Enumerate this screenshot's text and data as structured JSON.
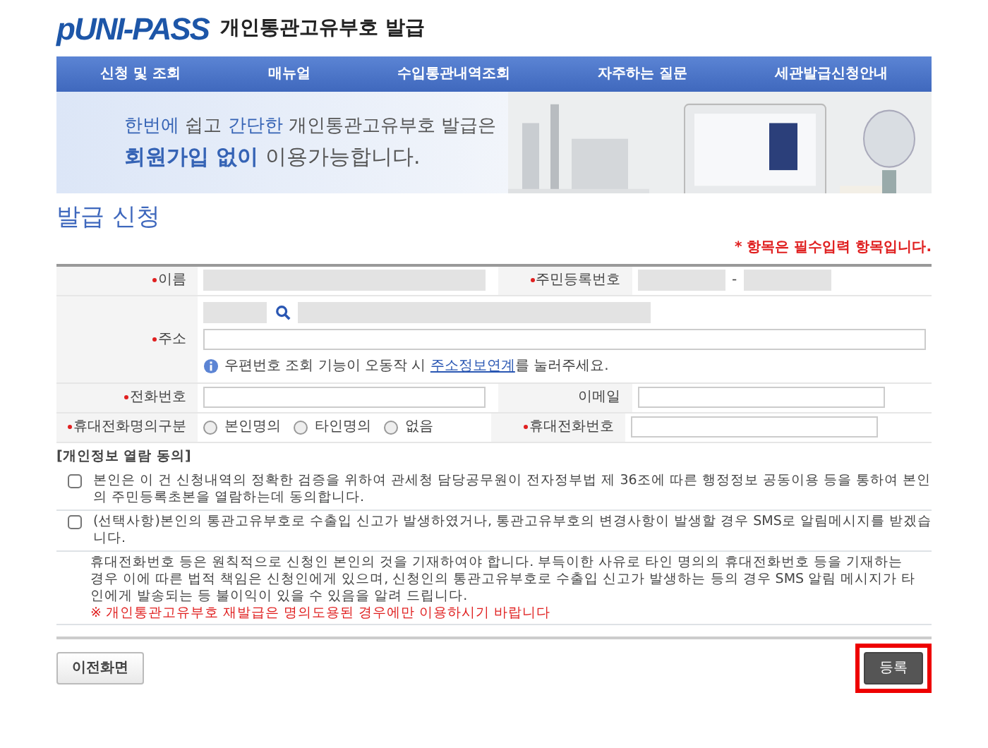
{
  "header": {
    "logo": "pUNI-PASS",
    "title": "개인통관고유부호 발급"
  },
  "nav": [
    {
      "label": "신청 및 조회"
    },
    {
      "label": "매뉴얼"
    },
    {
      "label": "수입통관내역조회"
    },
    {
      "label": "자주하는 질문"
    },
    {
      "label": "세관발급신청안내"
    }
  ],
  "banner": {
    "lines": [
      [
        {
          "text": "한번에",
          "emphasis": true
        },
        {
          "text": " 쉽고 ",
          "emphasis": false
        },
        {
          "text": "간단한",
          "emphasis": true
        },
        {
          "text": " 개인통관고유부호 발급은",
          "emphasis": false
        }
      ],
      [
        {
          "text": "회원가입 없이",
          "emphasis": true
        },
        {
          "text": " 이용가능합니다.",
          "emphasis": false
        }
      ]
    ],
    "kind": "picture"
  },
  "page_title": "발급 신청",
  "required_note": "* 항목은 필수입력 항목입니다.",
  "form": [
    {
      "kind": "pair",
      "cells": [
        {
          "label": "이름",
          "required": true,
          "fields": [
            {
              "disabled": true
            }
          ]
        },
        {
          "label": "주민등록번호",
          "required": true,
          "fields": [
            {
              "disabled": true
            },
            {
              "disabled": true
            }
          ],
          "separator": "-"
        }
      ]
    },
    {
      "kind": "address",
      "label": "주소",
      "required": true,
      "zip": {
        "disabled": true
      },
      "line1": {
        "disabled": true
      },
      "line2": {
        "disabled": false
      },
      "info": {
        "before": "우편번호 조회 기능이 오동작 시 ",
        "link": "주소정보연계",
        "after": "를 눌러주세요."
      }
    },
    {
      "kind": "pair",
      "cells": [
        {
          "label": "전화번호",
          "required": true,
          "fields": [
            {
              "disabled": false
            }
          ]
        },
        {
          "label": "이메일",
          "required": false,
          "fields": [
            {
              "disabled": false
            }
          ]
        }
      ]
    },
    {
      "kind": "radio",
      "label": "휴대전화명의구분",
      "required": true,
      "options": [
        {
          "label": "본인명의",
          "selected": false
        },
        {
          "label": "타인명의",
          "selected": false
        },
        {
          "label": "없음",
          "selected": false
        }
      ],
      "other": {
        "label": "휴대전화번호",
        "required": true,
        "fields": [
          {
            "disabled": false
          }
        ]
      }
    }
  ],
  "consent": {
    "heading": "[개인정보 열람 동의]",
    "items": [
      {
        "text": "본인은 이 건 신청내역의 정확한 검증을 위하여 관세청 담당공무원이 전자정부법 제 36조에 따른 행정정보 공동이용 등을 통하여 본인의 주민등록초본을 열람하는데 동의합니다.",
        "checked": false
      },
      {
        "text": "(선택사항)본인의 통관고유부호로 수출입 신고가 발생하였거나, 통관고유부호의 변경사항이 발생할 경우 SMS로 알림메시지를 받겠습니다.",
        "checked": false
      }
    ]
  },
  "notice": {
    "text": "휴대전화번호 등은 원칙적으로 신청인 본인의 것을 기재하여야 합니다. 부득이한 사유로 타인 명의의 휴대전화번호 등을 기재하는 경우 이에 따른 법적 책임은 신청인에게 있으며, 신청인의 통관고유부호로 수출입 신고가 발생하는 등의 경우 SMS 알림 메시지가 타인에게 발송되는 등 불이익이 있을 수 있음을 알려 드립니다.",
    "warning": "※ 개인통관고유부호 재발급은 명의도용된 경우에만 이용하시기 바랍니다"
  },
  "buttons": [
    {
      "label": "이전화면",
      "kind": "back",
      "highlighted": false
    },
    {
      "label": "등록",
      "kind": "submit",
      "highlighted": true
    }
  ]
}
